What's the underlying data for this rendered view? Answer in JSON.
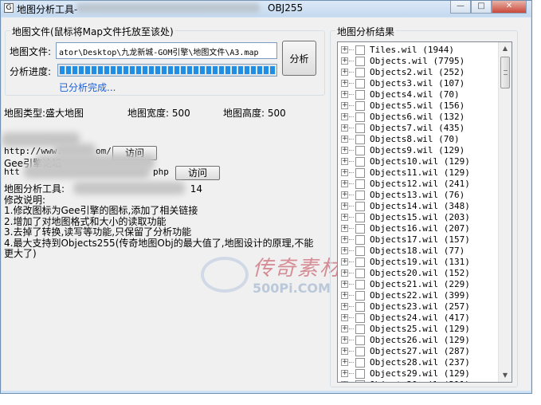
{
  "window": {
    "title": "地图分析工具-",
    "title_suffix": "OBJ255",
    "app_icon": "G"
  },
  "map_file": {
    "group_label": "地图文件(鼠标将Map文件托放至该处)",
    "file_label": "地图文件:",
    "file_path": "ator\\Desktop\\九龙新城-GOM引擎\\地图文件\\A3.map",
    "progress_label": "分析进度:",
    "analyze_button": "分析",
    "progress_percent": 100,
    "status": "已分析完成..."
  },
  "map_info": {
    "type_label": "地图类型:盛大地图",
    "width_label": "地图宽度: 500",
    "height_label": "地图高度: 500"
  },
  "links": {
    "link1_prefix": "http://www.",
    "link1_suffix": "om/",
    "visit1": "访问",
    "link2_prefix": "Gee引擎论坛",
    "link3_prefix": "htt",
    "link3_suffix": "php",
    "visit2": "访问"
  },
  "description": {
    "tool_label": "地图分析工具:",
    "tool_suffix": "14",
    "changelog_title": "修改说明:",
    "lines": [
      "1.修改图标为Gee引擎的图标,添加了相关链接",
      "2.增加了对地图格式和大小的读取功能",
      "3.去掉了转换,读写等功能,只保留了分析功能",
      "4.最大支持到Objects255(传奇地图Obj的最大值了,地图设计的原理,不能更大了)"
    ]
  },
  "watermark": {
    "main": "传奇素材",
    "sub": "500Pi.COM"
  },
  "results": {
    "group_label": "地图分析结果",
    "items": [
      {
        "label": "Tiles.wil (1944)"
      },
      {
        "label": "Objects.wil (7795)"
      },
      {
        "label": "Objects2.wil (252)"
      },
      {
        "label": "Objects3.wil (107)"
      },
      {
        "label": "Objects4.wil (70)"
      },
      {
        "label": "Objects5.wil (156)"
      },
      {
        "label": "Objects6.wil (132)"
      },
      {
        "label": "Objects7.wil (435)"
      },
      {
        "label": "Objects8.wil (70)"
      },
      {
        "label": "Objects9.wil (129)"
      },
      {
        "label": "Objects10.wil (129)"
      },
      {
        "label": "Objects11.wil (129)"
      },
      {
        "label": "Objects12.wil (241)"
      },
      {
        "label": "Objects13.wil (76)"
      },
      {
        "label": "Objects14.wil (348)"
      },
      {
        "label": "Objects15.wil (203)"
      },
      {
        "label": "Objects16.wil (207)"
      },
      {
        "label": "Objects17.wil (157)"
      },
      {
        "label": "Objects18.wil (77)"
      },
      {
        "label": "Objects19.wil (131)"
      },
      {
        "label": "Objects20.wil (152)"
      },
      {
        "label": "Objects21.wil (229)"
      },
      {
        "label": "Objects22.wil (399)"
      },
      {
        "label": "Objects23.wil (257)"
      },
      {
        "label": "Objects24.wil (417)"
      },
      {
        "label": "Objects25.wil (129)"
      },
      {
        "label": "Objects26.wil (129)"
      },
      {
        "label": "Objects27.wil (287)"
      },
      {
        "label": "Objects28.wil (237)"
      },
      {
        "label": "Objects29.wil (129)"
      },
      {
        "label": "Objects30.wil (211)"
      }
    ]
  }
}
